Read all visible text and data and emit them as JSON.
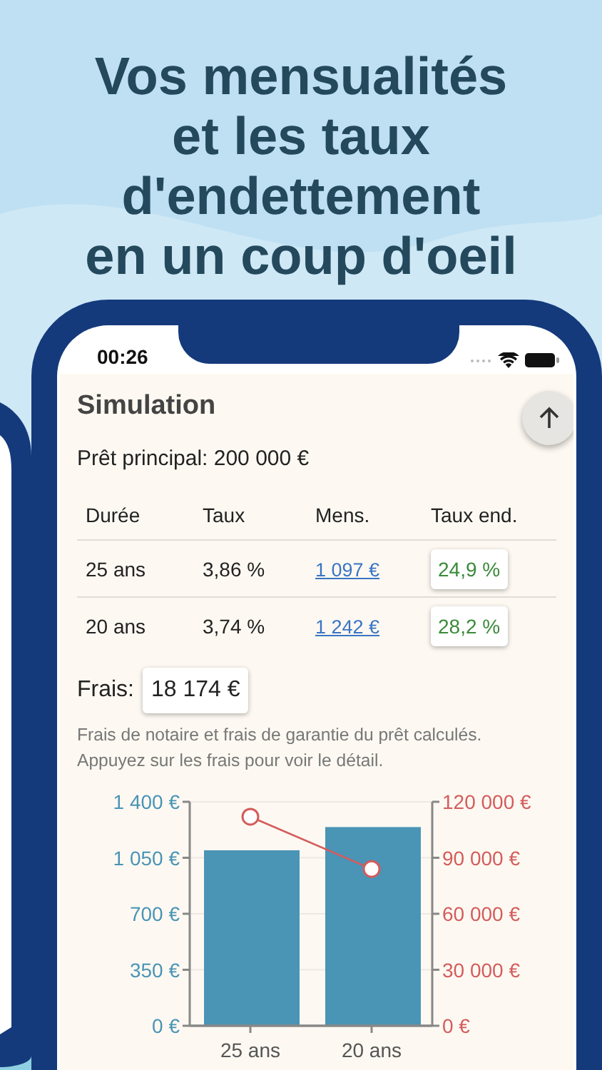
{
  "headline": "Vos mensualités\net les taux\nd'endettement\nen un coup d'oeil",
  "status_bar": {
    "time": "00:26"
  },
  "screen": {
    "title": "Simulation",
    "principal": "Prêt principal: 200 000 €",
    "table": {
      "columns": [
        "Durée",
        "Taux",
        "Mens.",
        "Taux end."
      ],
      "rows": [
        {
          "duree": "25 ans",
          "taux": "3,86 %",
          "mens": "1 097 €",
          "taux_end": "24,9 %"
        },
        {
          "duree": "20 ans",
          "taux": "3,74 %",
          "mens": "1 242 €",
          "taux_end": "28,2 %"
        }
      ]
    },
    "fees_label": "Frais:",
    "fees_value": "18 174 €",
    "note": "Frais de notaire et frais de garantie du prêt calculés.\nAppuyez sur les frais pour voir le détail.",
    "charts": [
      {
        "chart_data": {
          "type": "bar",
          "categories": [
            "25 ans",
            "20 ans"
          ],
          "series": [
            {
              "color": "#4a94b6",
              "values": [
                1097,
                1242
              ]
            }
          ],
          "grid": true,
          "ylim": [
            0,
            1400
          ],
          "yticks": [
            {
              "value": 0,
              "label": "0 €"
            },
            {
              "value": 350,
              "label": "350 €"
            },
            {
              "value": 700,
              "label": "700 €"
            },
            {
              "value": 1050,
              "label": "1 050 €"
            },
            {
              "value": 1400,
              "label": "1 400 €"
            }
          ]
        }
      },
      {
        "chart_data": {
          "type": "line",
          "categories": [
            null,
            null
          ],
          "series": [
            {
              "color": "#d45c5c",
              "marker": "circle",
              "values": [
                112000,
                84000
              ]
            }
          ],
          "ylim": [
            0,
            120000
          ],
          "yticks": [
            {
              "value": 0,
              "label": "0 €"
            },
            {
              "value": 30000,
              "label": "30 000 €"
            },
            {
              "value": 60000,
              "label": "60 000 €"
            },
            {
              "value": 90000,
              "label": "90 000 €"
            },
            {
              "value": 120000,
              "label": "120 000 €"
            }
          ]
        }
      }
    ]
  }
}
